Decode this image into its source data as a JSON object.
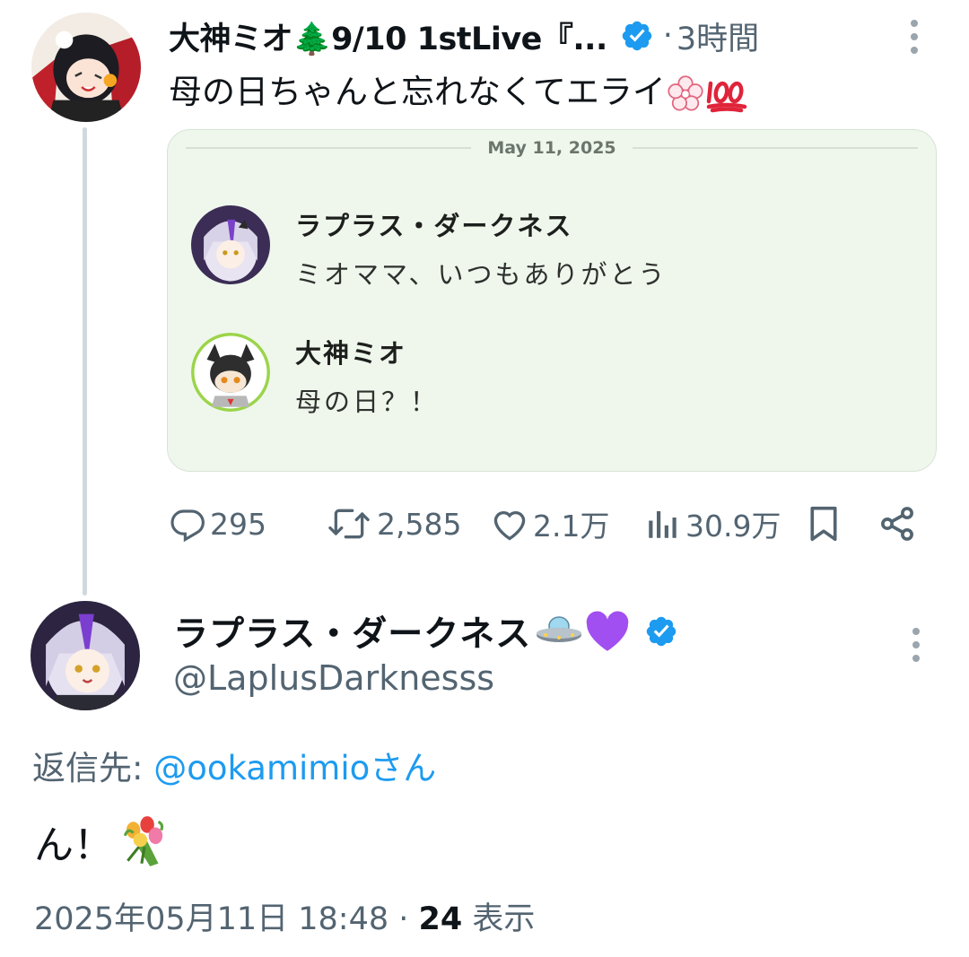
{
  "parent_tweet": {
    "display_name": "大神ミオ🌲9/10 1stLive『...",
    "time_sep": "·",
    "time": "3時間",
    "text": "母の日ちゃんと忘れなくてエライ",
    "icons": [
      "avatar",
      "verified-badge-icon",
      "more-options-icon",
      "sakura-emoji-icon",
      "hundred-points-emoji-icon"
    ],
    "media": {
      "date": "May 11, 2025",
      "messages": [
        {
          "name": "ラプラス・ダークネス",
          "text": "ミオママ、いつもありがとう"
        },
        {
          "name": "大神ミオ",
          "text": "母の日？！"
        }
      ]
    },
    "actions": {
      "replies": "295",
      "reposts": "2,585",
      "likes": "2.1万",
      "views": "30.9万"
    }
  },
  "reply_tweet": {
    "display_name": "ラプラス・ダークネス",
    "name_emoji": "🛸💜",
    "handle": "@LaplusDarknesss",
    "replying_label": "返信先: ",
    "replying_to": "@ookamimioさん",
    "text": "ん！",
    "timestamp": "2025年05月11日 18:48",
    "meta_sep": " · ",
    "views_count": "24",
    "views_label": " 表示"
  },
  "colors": {
    "verified": "#1d9bf0",
    "secondary_text": "#536471",
    "link": "#1d9bf0",
    "media_bg": "#eff7ec"
  }
}
